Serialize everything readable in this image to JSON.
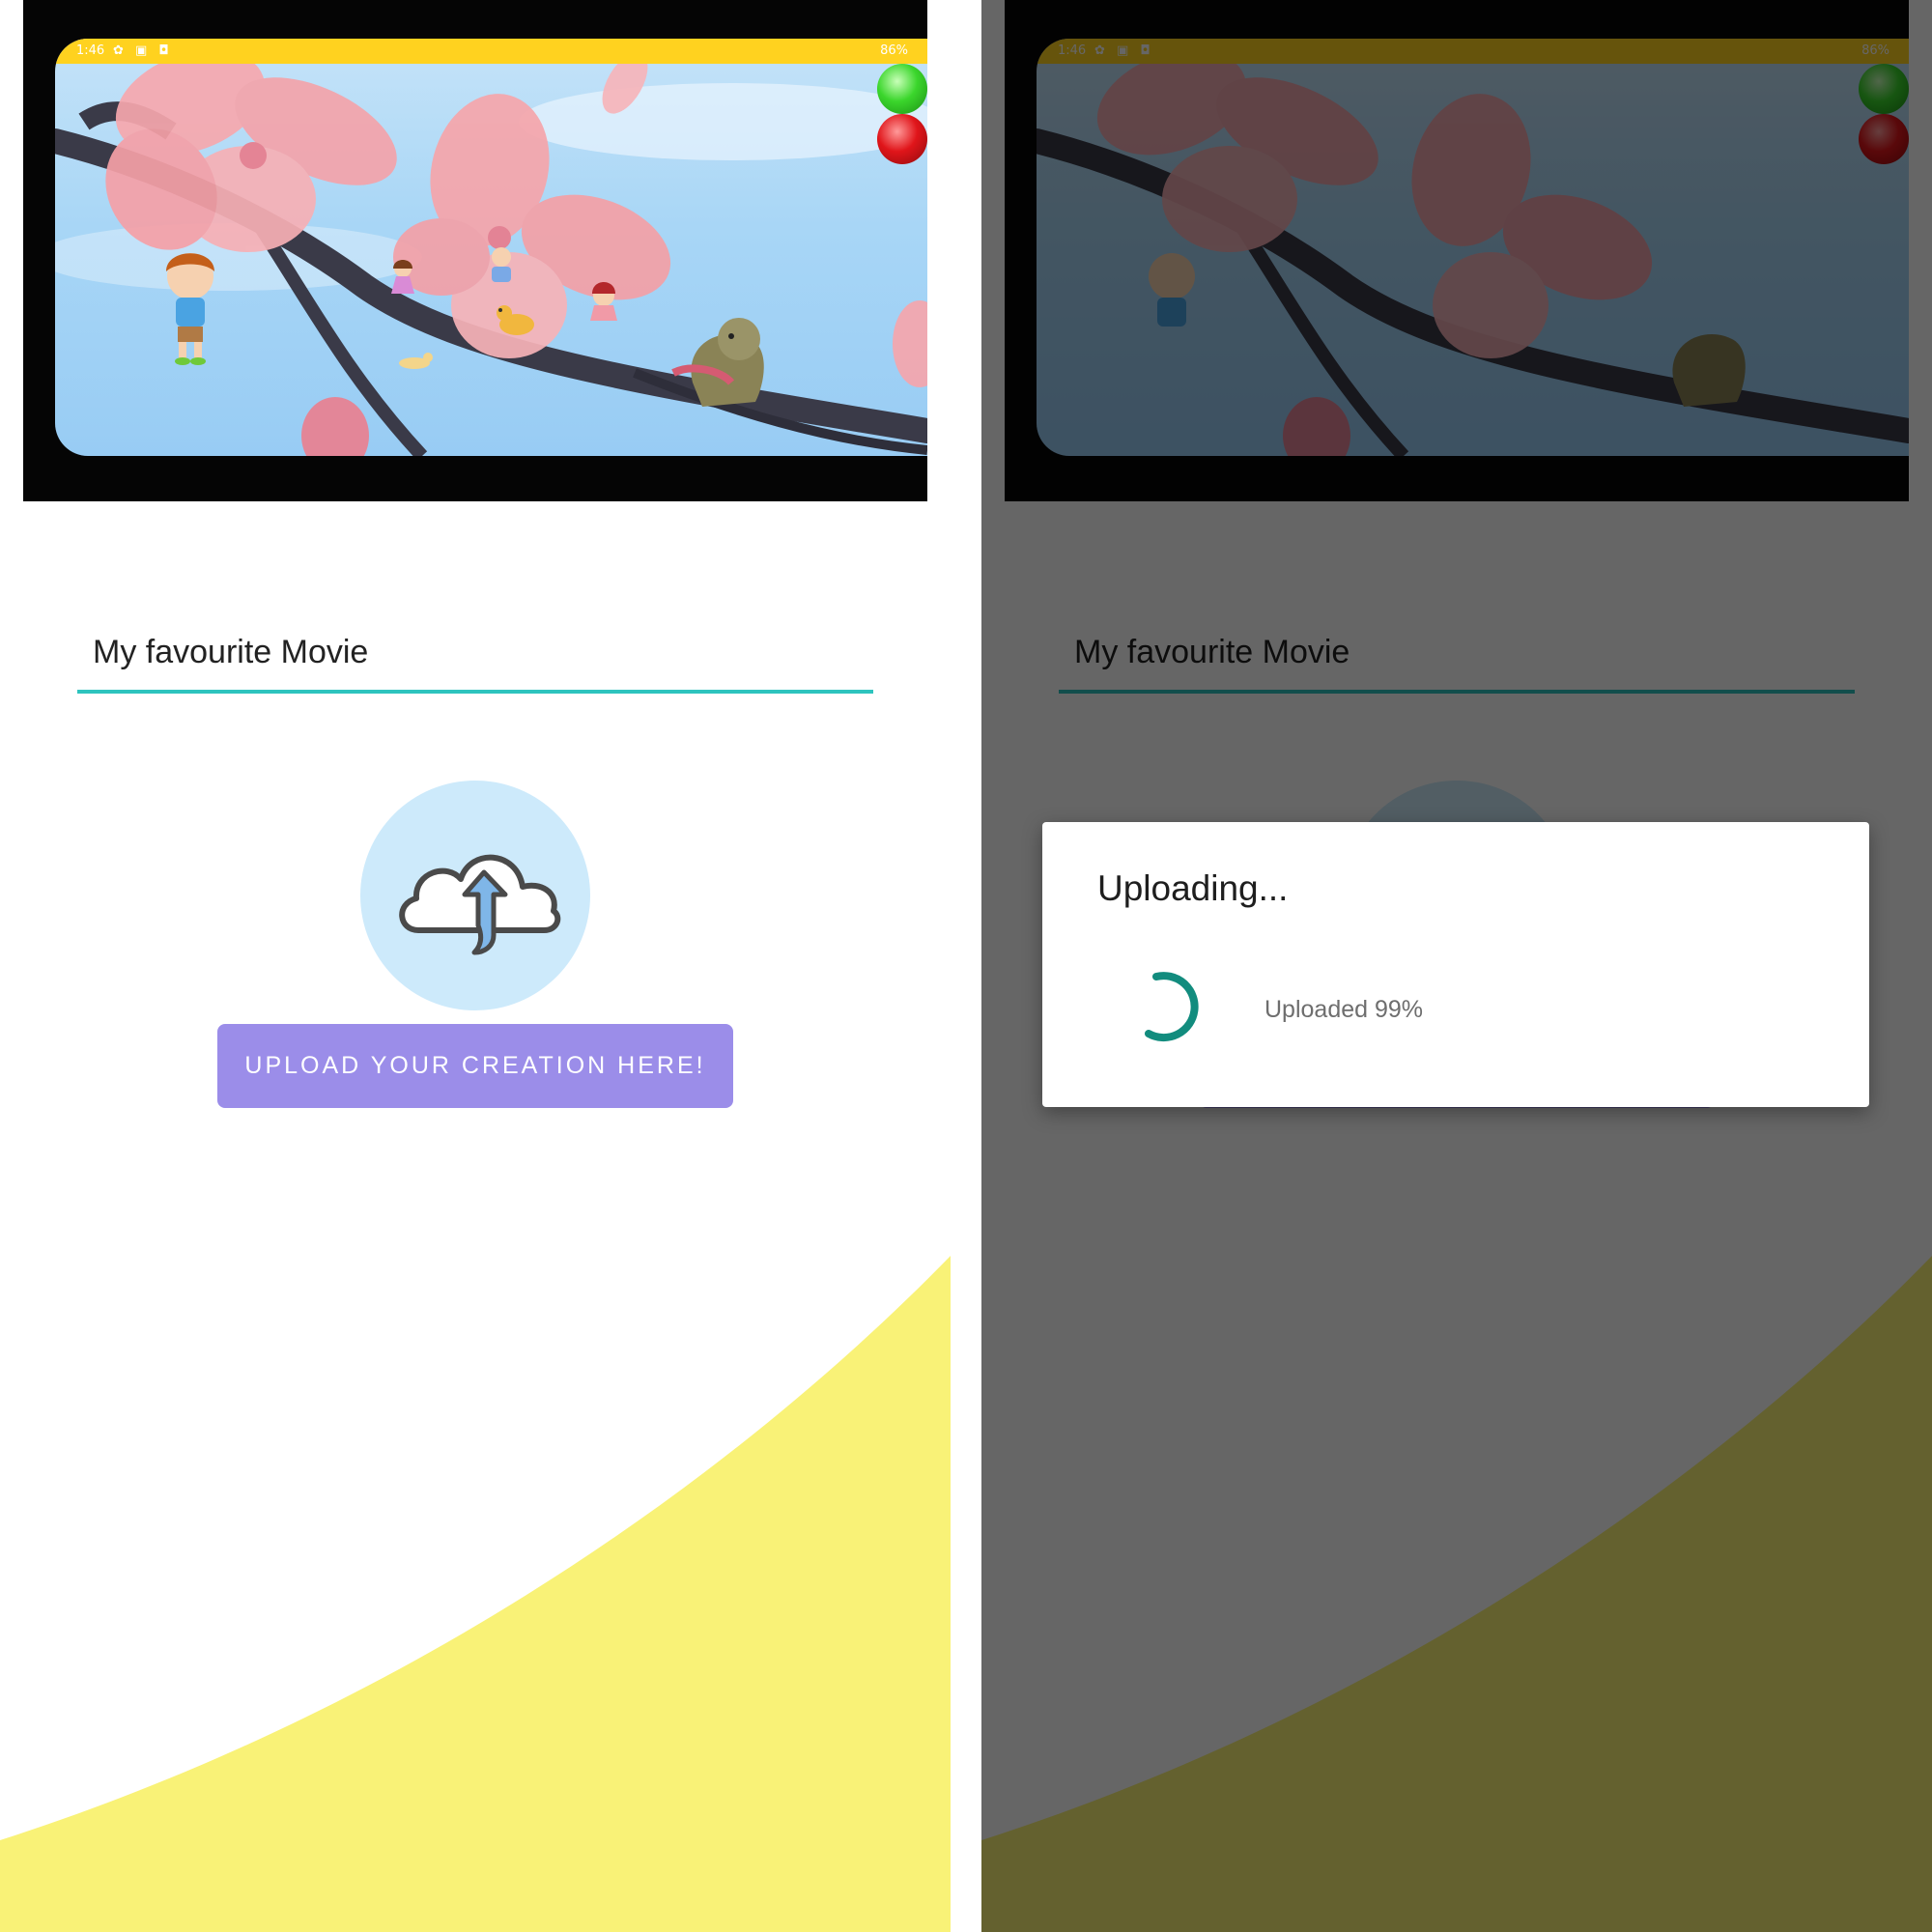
{
  "phone_status": {
    "time": "1:46",
    "battery": "86%"
  },
  "form": {
    "title_value": "My favourite Movie",
    "upload_button_label": "Upload your creation here!"
  },
  "dialog": {
    "title": "Uploading...",
    "status": "Uploaded 99%",
    "progress_percent": 99
  },
  "colors": {
    "accent_teal": "#2ec4be",
    "dialog_spinner": "#128c7e",
    "button_purple": "#9b8de9",
    "upload_circle": "#cdeafb",
    "wave_yellow": "#f9f277",
    "phone_status_bar": "#ffd21f"
  },
  "icons": {
    "upload": "cloud-upload-icon",
    "play": "green-circle-button",
    "stop": "red-circle-button"
  }
}
